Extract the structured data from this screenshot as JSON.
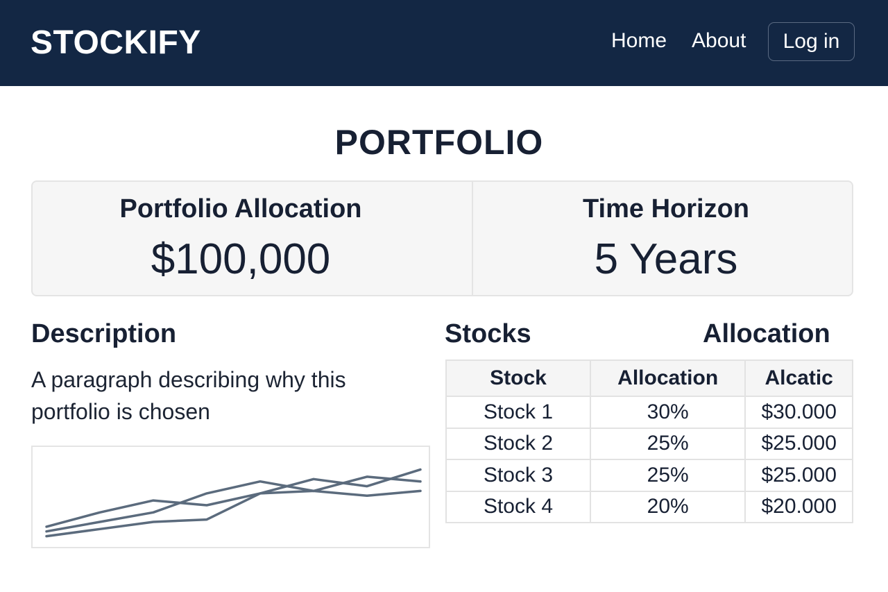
{
  "header": {
    "brand": "STOCKIFY",
    "nav": {
      "home": "Home",
      "about": "About",
      "login": "Log in"
    }
  },
  "page_title": "PORTFOLIO",
  "summary": {
    "allocation_label": "Portfolio Allocation",
    "allocation_value": "$100,000",
    "horizon_label": "Time Horizon",
    "horizon_value": "5 Years"
  },
  "description": {
    "heading": "Description",
    "text": "A paragraph describing why this portfolio is chosen"
  },
  "stocks": {
    "heading": "Stocks",
    "allocation_heading": "Allocation",
    "columns": [
      "Stock",
      "Allocation",
      "Alcatic"
    ],
    "rows": [
      [
        "Stock 1",
        "30%",
        "$30.000"
      ],
      [
        "Stock 2",
        "25%",
        "$25.000"
      ],
      [
        "Stock 3",
        "25%",
        "$25.000"
      ],
      [
        "Stock 4",
        "20%",
        "$20.000"
      ]
    ]
  },
  "chart_data": {
    "type": "line",
    "x": [
      0,
      1,
      2,
      3,
      4,
      5,
      6,
      7
    ],
    "series": [
      {
        "values": [
          10,
          22,
          32,
          28,
          38,
          50,
          44,
          58
        ]
      },
      {
        "values": [
          6,
          14,
          22,
          38,
          48,
          40,
          52,
          48
        ]
      },
      {
        "values": [
          2,
          8,
          14,
          16,
          38,
          40,
          36,
          40
        ]
      }
    ],
    "ylim": [
      0,
      70
    ],
    "line_color": "#5b6b7d"
  }
}
